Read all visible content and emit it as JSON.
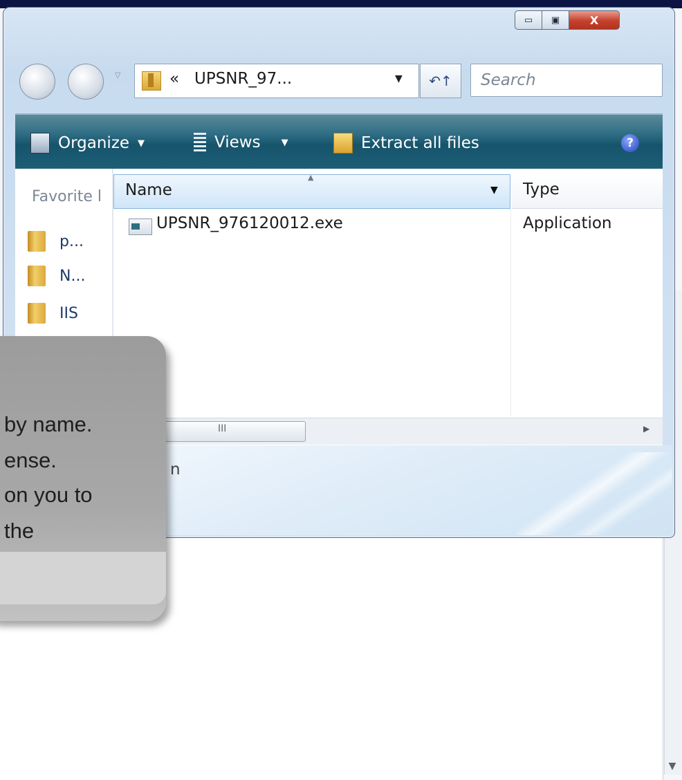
{
  "window": {
    "caption_buttons": {
      "minimize": "▭",
      "maximize": "▣",
      "close": "X"
    }
  },
  "navbar": {
    "address": {
      "chevron": "«",
      "path": "UPSNR_97..."
    },
    "search_placeholder": "Search",
    "refresh_symbol": "↶↑"
  },
  "toolbar": {
    "organize": "Organize",
    "views": "Views",
    "extract": "Extract all files",
    "help": "?"
  },
  "navpane": {
    "heading": "Favorite l",
    "items": [
      {
        "label": "p..."
      },
      {
        "label": "N..."
      },
      {
        "label": "IIS"
      }
    ]
  },
  "filelist": {
    "columns": {
      "name": "Name",
      "type": "Type"
    },
    "rows": [
      {
        "name": "UPSNR_976120012.exe",
        "type": "Application"
      }
    ]
  },
  "scrollbar": {
    "grip": "III"
  },
  "details_fragment": "n",
  "callout": {
    "lines": [
      "by name.",
      "ense.",
      "on you to",
      "the"
    ]
  },
  "icons": {
    "organize": "organize-icon",
    "views": "views-icon",
    "extract": "extract-icon",
    "help": "help-icon",
    "folder": "folder-icon",
    "exe": "exe-file-icon"
  }
}
